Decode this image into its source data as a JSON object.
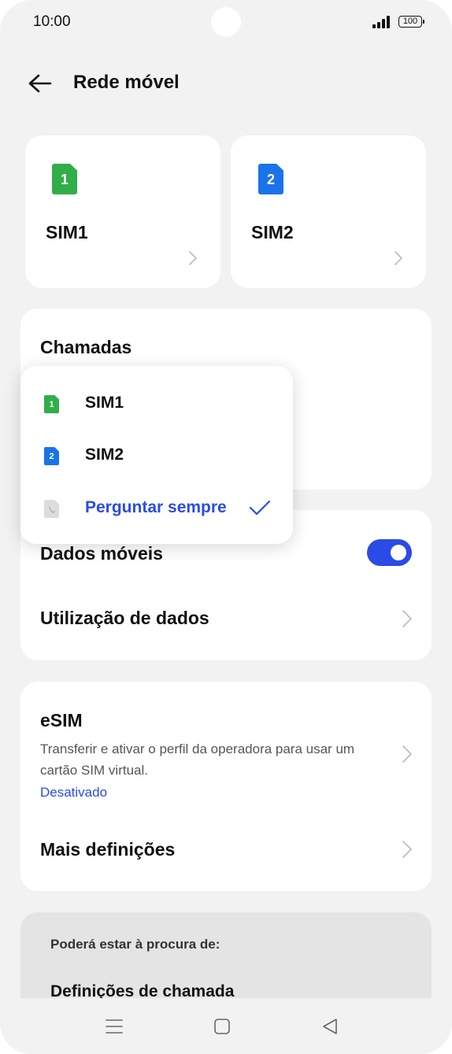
{
  "status": {
    "time": "10:00",
    "battery": "100"
  },
  "header": {
    "title": "Rede móvel"
  },
  "sims": [
    {
      "badge": "1",
      "name": "SIM1",
      "color": "#2fae4a"
    },
    {
      "badge": "2",
      "name": "SIM2",
      "color": "#1a73e8"
    }
  ],
  "calls": {
    "title": "Chamadas"
  },
  "popup": {
    "items": [
      {
        "badge": "1",
        "label": "SIM1"
      },
      {
        "badge": "2",
        "label": "SIM2"
      },
      {
        "label": "Perguntar sempre",
        "selected": true
      }
    ]
  },
  "data_card": {
    "mobile_data": "Dados móveis",
    "mobile_data_on": true,
    "data_usage": "Utilização de dados"
  },
  "esim": {
    "title": "eSIM",
    "description": "Transferir e ativar o perfil da operadora para usar um cartão SIM virtual.",
    "status": "Desativado",
    "more": "Mais definições"
  },
  "suggestions": {
    "label": "Poderá estar à procura de:",
    "items": [
      "Definições de chamada"
    ]
  },
  "colors": {
    "accent": "#2b4be6",
    "sim1": "#2fae4a",
    "sim2": "#1a73e8"
  }
}
